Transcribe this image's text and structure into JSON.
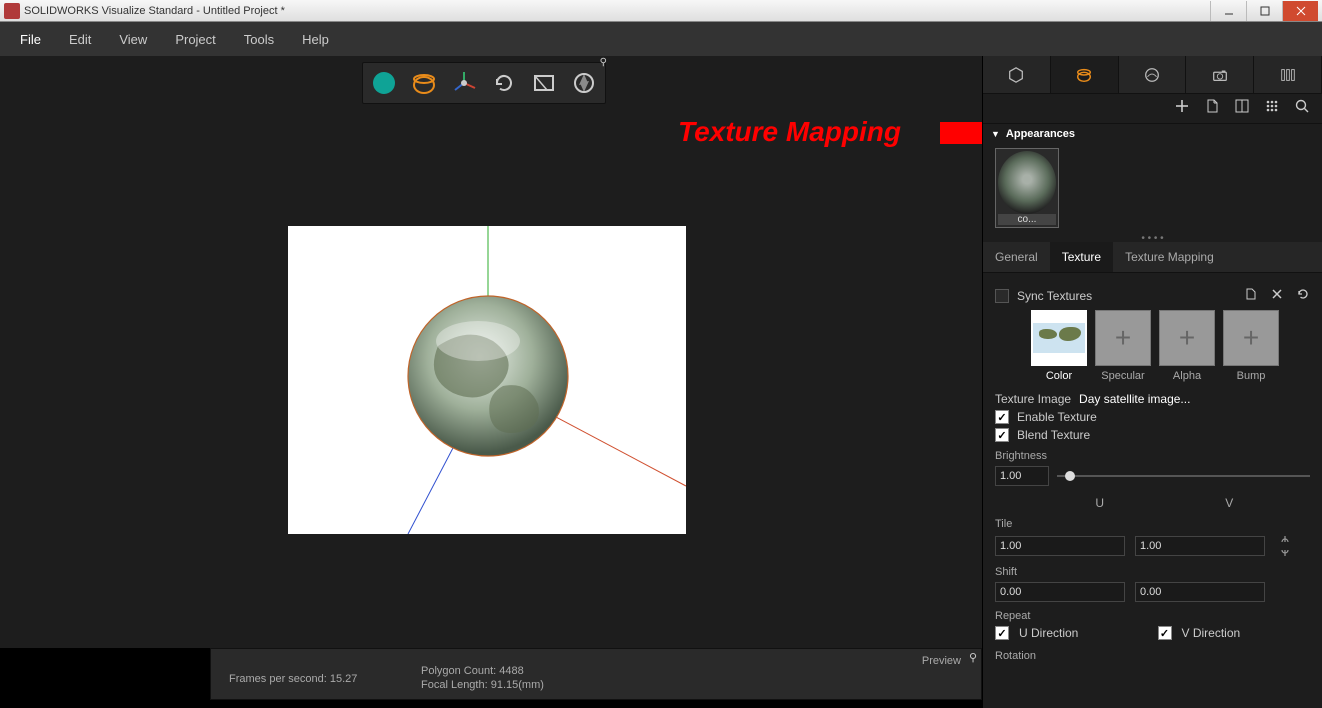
{
  "window": {
    "title": "SOLIDWORKS Visualize Standard - Untitled Project *"
  },
  "menu": {
    "file": "File",
    "edit": "Edit",
    "view": "View",
    "project": "Project",
    "tools": "Tools",
    "help": "Help"
  },
  "annotation": {
    "text": "Texture Mapping"
  },
  "rpanel": {
    "appearances_label": "Appearances",
    "thumb_label": "co...",
    "tabs": {
      "general": "General",
      "texture": "Texture",
      "mapping": "Texture Mapping"
    },
    "sync": "Sync Textures",
    "slots": {
      "color": "Color",
      "specular": "Specular",
      "alpha": "Alpha",
      "bump": "Bump"
    },
    "texture_image_label": "Texture Image",
    "texture_image_value": "Day satellite image...",
    "enable": "Enable Texture",
    "blend": "Blend Texture",
    "brightness_label": "Brightness",
    "brightness_value": "1.00",
    "u": "U",
    "v": "V",
    "tile": "Tile",
    "tile_u": "1.00",
    "tile_v": "1.00",
    "shift": "Shift",
    "shift_u": "0.00",
    "shift_v": "0.00",
    "repeat": "Repeat",
    "udir": "U Direction",
    "vdir": "V Direction",
    "rotation": "Rotation"
  },
  "status": {
    "preview": "Preview",
    "fps": "Frames per second: 15.27",
    "poly": "Polygon Count: 4488",
    "focal": "Focal Length: 91.15(mm)"
  },
  "colors": {
    "accent": "#e88b1a",
    "red": "#ff0000",
    "teal": "#0fa396"
  }
}
